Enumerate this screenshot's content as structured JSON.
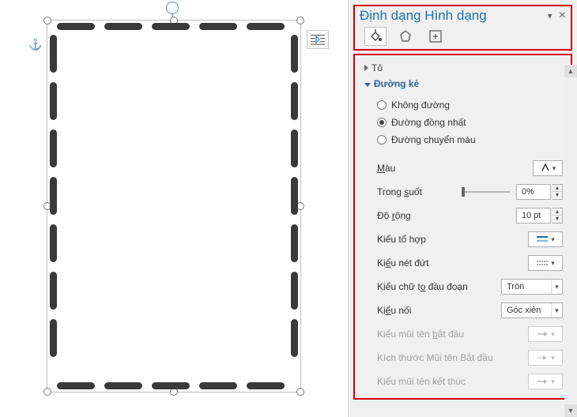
{
  "header": {
    "title": "Định dạng Hình dạng",
    "dropdown_glyph": "▾",
    "close_glyph": "×"
  },
  "sections": {
    "fill": "Tô",
    "line": "Đường kẻ"
  },
  "line_options": {
    "none": "Không đường",
    "solid": "Đường đồng nhất",
    "gradient": "Đường chuyển màu"
  },
  "props": {
    "color": {
      "label_pre": "",
      "label_ul": "M",
      "label_post": "àu"
    },
    "transparency": {
      "label_pre": "Trong ",
      "label_ul": "s",
      "label_post": "uốt",
      "value": "0%"
    },
    "width": {
      "label_pre": "Độ ",
      "label_ul": "r",
      "label_post": "ộng",
      "value": "10 pt"
    },
    "compound": {
      "label": "Kiểu tổ hợp"
    },
    "dash": {
      "label_pre": "Ki",
      "label_ul": "ể",
      "label_post": "u nét đứt"
    },
    "cap": {
      "label_pre": "Kiểu chữ t",
      "label_ul": "o",
      "label_post": " đầu đoạn",
      "value": "Tròn"
    },
    "join": {
      "label_pre": "Ki",
      "label_ul": "ể",
      "label_post": "u nối",
      "value": "Góc xiên"
    },
    "begin_arrow": {
      "label_pre": "Kiểu mũi tên ",
      "label_ul": "b",
      "label_post": "ắt đầu"
    },
    "begin_size": {
      "label": "Kích thước Mũi tên Bắt đầu"
    },
    "end_arrow": {
      "label": "Kiểu mũi tên kết thúc"
    }
  }
}
